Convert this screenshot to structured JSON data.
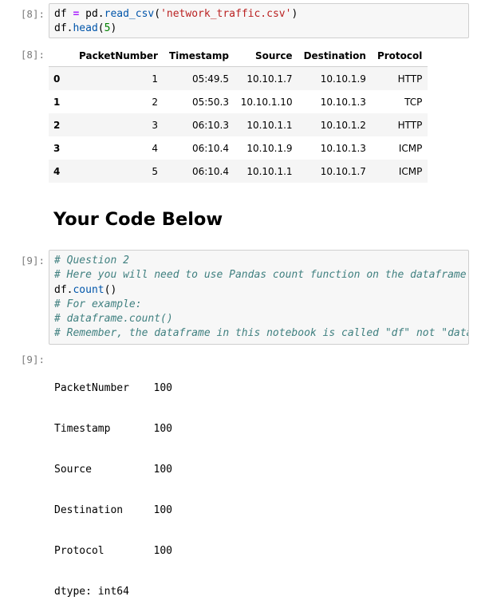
{
  "cells": {
    "cell8_in_prompt": "[8]:",
    "cell8_out_prompt": "[8]:",
    "cell9_in_prompt": "[9]:",
    "cell9_out_prompt": "[9]:"
  },
  "cell8_code": {
    "line1": {
      "var": "df",
      "op": "=",
      "obj": "pd.",
      "fn": "read_csv",
      "open": "(",
      "arg": "'network_traffic.csv'",
      "close": ")"
    },
    "line2": {
      "obj": "df.",
      "fn": "head",
      "open": "(",
      "arg": "5",
      "close": ")"
    }
  },
  "table": {
    "columns": [
      "PacketNumber",
      "Timestamp",
      "Source",
      "Destination",
      "Protocol"
    ],
    "rows": [
      {
        "index": "0",
        "cells": [
          "1",
          "05:49.5",
          "10.10.1.7",
          "10.10.1.9",
          "HTTP"
        ]
      },
      {
        "index": "1",
        "cells": [
          "2",
          "05:50.3",
          "10.10.1.10",
          "10.10.1.3",
          "TCP"
        ]
      },
      {
        "index": "2",
        "cells": [
          "3",
          "06:10.3",
          "10.10.1.1",
          "10.10.1.2",
          "HTTP"
        ]
      },
      {
        "index": "3",
        "cells": [
          "4",
          "06:10.4",
          "10.10.1.9",
          "10.10.1.3",
          "ICMP"
        ]
      },
      {
        "index": "4",
        "cells": [
          "5",
          "06:10.4",
          "10.10.1.1",
          "10.10.1.7",
          "ICMP"
        ]
      }
    ]
  },
  "heading": "Your Code Below",
  "cell9_code": {
    "comment1": "# Question 2",
    "comment2": "# Here you will need to use Pandas count function on the dataframe",
    "code_obj": "df.",
    "code_fn": "count",
    "code_paren": "()",
    "comment3": "# For example:",
    "comment4": "# dataframe.count()",
    "comment5": "# Remember, the dataframe in this notebook is called \"df\" not \"data"
  },
  "output": {
    "rows": [
      {
        "name": "PacketNumber",
        "value": "100"
      },
      {
        "name": "Timestamp",
        "value": "100"
      },
      {
        "name": "Source",
        "value": "100"
      },
      {
        "name": "Destination",
        "value": "100"
      },
      {
        "name": "Protocol",
        "value": "100"
      }
    ],
    "dtype": "dtype: int64"
  }
}
